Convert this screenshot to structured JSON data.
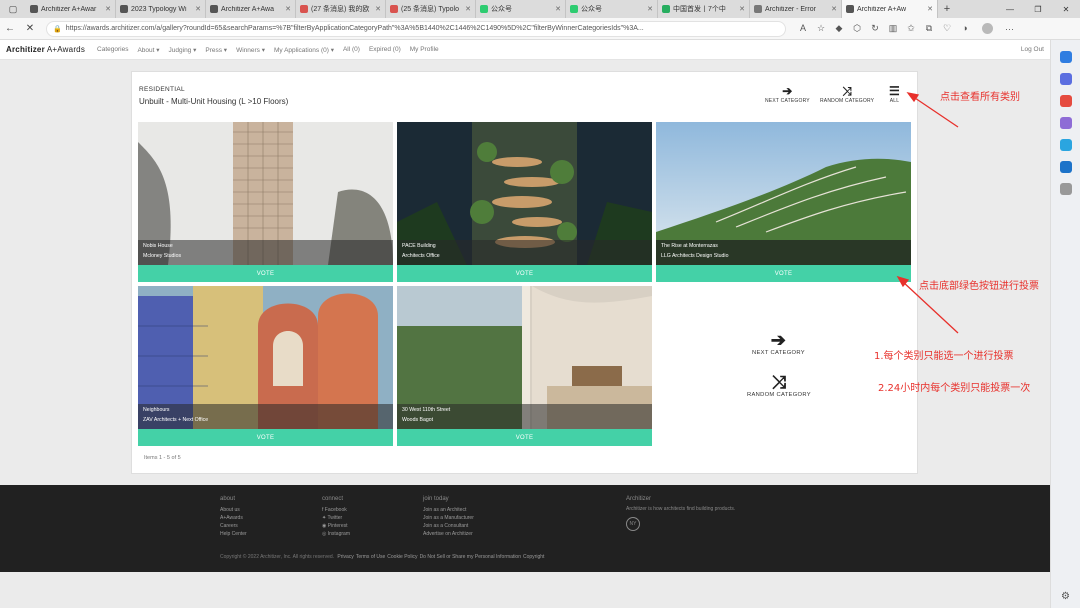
{
  "browser": {
    "tabs": [
      {
        "label": "Architizer A+Awar",
        "color": "#555555",
        "active": false
      },
      {
        "label": "2023 Typology Wi",
        "color": "#555555",
        "active": false
      },
      {
        "label": "Architizer A+Awa",
        "color": "#555555",
        "active": false
      },
      {
        "label": "(27 条消息) 我的欧",
        "color": "#d9534f",
        "active": false
      },
      {
        "label": "(25 条消息) Typolo",
        "color": "#d9534f",
        "active": false
      },
      {
        "label": "公众号",
        "color": "#2ecc71",
        "active": false
      },
      {
        "label": "公众号",
        "color": "#2ecc71",
        "active": false
      },
      {
        "label": "中国首发丨7个中",
        "color": "#27ae60",
        "active": false
      },
      {
        "label": "Architizer - Error",
        "color": "#777777",
        "active": false
      },
      {
        "label": "Architizer A+Aw",
        "color": "#555555",
        "active": true
      }
    ],
    "url": "https://awards.architizer.com/a/gallery?roundId=65&searchParams=%7B\"filterByApplicationCategoryPath\"%3A%5B1440%2C1446%2C1490%5D%2C\"filterByWinnerCategoriesIds\"%3A..."
  },
  "site": {
    "logo_bold": "Architizer",
    "logo_light": " A+Awards",
    "nav": [
      "Categories",
      "About ▾",
      "Judging ▾",
      "Press ▾",
      "Winners ▾",
      "My Applications (0) ▾",
      "All (0)",
      "Expired (0)",
      "My Profile"
    ],
    "logout": "Log Out"
  },
  "gallery": {
    "category_small": "RESIDENTIAL",
    "category_title": "Unbuilt - Multi-Unit Housing (L >10 Floors)",
    "top_actions": {
      "next": "NEXT CATEGORY",
      "random": "RANDOM CATEGORY",
      "all": "ALL"
    },
    "vote_label": "VOTE",
    "projects": [
      {
        "name": "Nobis House",
        "architect": "Mcloney Studios"
      },
      {
        "name": "PACE Building",
        "architect": "Architects Office"
      },
      {
        "name": "The Rise at Monterrazas",
        "architect": "LLG Architects Design Studio"
      },
      {
        "name": "Neighbours",
        "architect": "ZAV Architects + Next Office"
      },
      {
        "name": "30 West 110th Street",
        "architect": "Woods Bagot"
      }
    ],
    "mid_actions": {
      "next": "NEXT CATEGORY",
      "random": "RANDOM CATEGORY"
    },
    "items_count": "Items 1 - 5 of 5"
  },
  "annotations": {
    "view_all": "点击查看所有类别",
    "vote_button": "点击底部绿色按钮进行投票",
    "rule1": "1.每个类别只能选一个进行投票",
    "rule2": "2.24小时内每个类别只能投票一次"
  },
  "footer": {
    "about": {
      "head": "about",
      "links": [
        "About us",
        "A+Awards",
        "Careers",
        "Help Center"
      ]
    },
    "connect": {
      "head": "connect",
      "links": [
        "f  Facebook",
        "✦ Twitter",
        "◉ Pinterest",
        "◎ Instagram"
      ]
    },
    "join": {
      "head": "join today",
      "links": [
        "Join as an Architect",
        "Join as a Manufacturer",
        "Join as a Consultant",
        "Advertise on Architizer"
      ]
    },
    "brand": "Architizer",
    "tagline": "Architizer is how architects find building products.",
    "badge": "NY",
    "copyright": "Copyright © 2022 Architizer, Inc. All rights reserved.",
    "legal_links": [
      "Privacy",
      "Terms of Use",
      "Cookie Policy",
      "Do Not Sell or Share my Personal Information",
      "Copyright"
    ]
  },
  "colors": {
    "vote_green": "#44d1a7",
    "annotation_red": "#e8302b",
    "footer_bg": "#212121"
  }
}
